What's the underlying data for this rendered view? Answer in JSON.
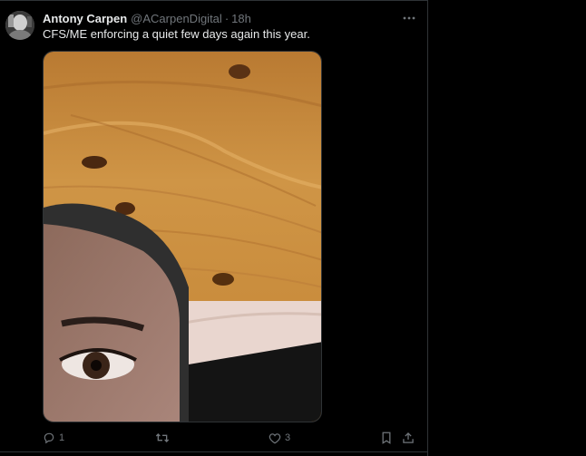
{
  "tweet": {
    "author_name": "Antony Carpen",
    "handle": "@ACarpenDigital",
    "separator": "·",
    "time": "18h",
    "text": "CFS/ME enforcing a quiet few days again this year."
  },
  "actions": {
    "reply_count": "1",
    "like_count": "3"
  },
  "icons": {
    "more": "more-horizontal-icon",
    "reply": "reply-icon",
    "retweet": "retweet-icon",
    "like": "heart-icon",
    "bookmark": "bookmark-icon",
    "share": "share-icon"
  },
  "colors": {
    "background": "#000000",
    "text_primary": "#e7e9ea",
    "text_secondary": "#71767b",
    "border": "#2f3336"
  }
}
